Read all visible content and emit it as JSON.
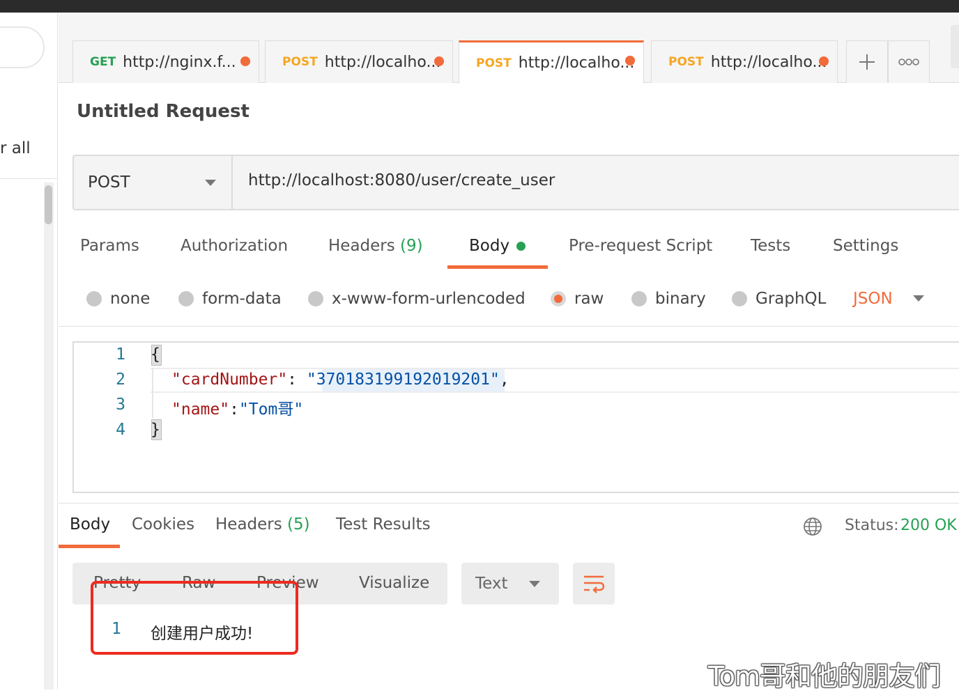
{
  "sidebar": {
    "filter_text": "r all"
  },
  "tabs": [
    {
      "method": "GET",
      "method_color": "#26a154",
      "url": "http://nginx.f..."
    },
    {
      "method": "POST",
      "method_color": "#f5a623",
      "url": "http://localho..."
    },
    {
      "method": "POST",
      "method_color": "#f5a623",
      "url": "http://localho...",
      "active": true
    },
    {
      "method": "POST",
      "method_color": "#f5a623",
      "url": "http://localho..."
    }
  ],
  "request": {
    "title": "Untitled Request",
    "method": "POST",
    "url": "http://localhost:8080/user/create_user"
  },
  "request_tabs": {
    "params": "Params",
    "authorization": "Authorization",
    "headers": "Headers",
    "headers_count": "(9)",
    "body": "Body",
    "prerequest": "Pre-request Script",
    "tests": "Tests",
    "settings": "Settings"
  },
  "body_types": {
    "none": "none",
    "form_data": "form-data",
    "urlencoded": "x-www-form-urlencoded",
    "raw": "raw",
    "binary": "binary",
    "graphql": "GraphQL",
    "format": "JSON",
    "selected": "raw"
  },
  "editor": {
    "line_numbers": [
      "1",
      "2",
      "3",
      "4"
    ],
    "open_brace": "{",
    "close_brace": "}",
    "line2_key": "\"cardNumber\"",
    "line2_sep": ": ",
    "line2_value": "\"370183199192019201\"",
    "line2_trail": ",",
    "line3_key": "\"name\"",
    "line3_sep": ":",
    "line3_value": "\"Tom哥\""
  },
  "response": {
    "tabs": {
      "body": "Body",
      "cookies": "Cookies",
      "headers": "Headers",
      "headers_count": "(5)",
      "test_results": "Test Results"
    },
    "status_label": "Status:",
    "status_value": "200 OK",
    "view_modes": [
      "Pretty",
      "Raw",
      "Preview",
      "Visualize"
    ],
    "format": "Text",
    "line_number": "1",
    "body_text": "创建用户成功!"
  },
  "watermark": "Tom哥和他的朋友们",
  "colors": {
    "accent": "#f26b3a",
    "success": "#26a154",
    "highlight_box": "#ee2a1f"
  },
  "icons": {
    "add_tab": "plus-icon",
    "more": "more-icon",
    "globe": "globe-icon",
    "wrap": "wrap-lines-icon"
  }
}
